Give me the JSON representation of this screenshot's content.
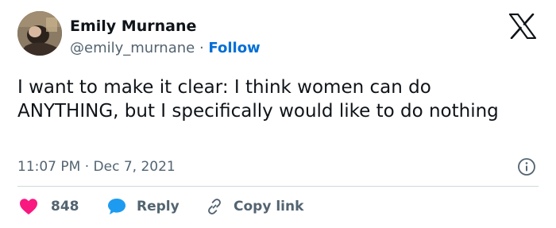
{
  "author": {
    "name": "Emily Murnane",
    "handle": "@emily_murnane",
    "separator": "·",
    "follow_label": "Follow"
  },
  "tweet": {
    "text": "I want to make it clear: I think women can do ANYTHING, but I specifically would like to do nothing",
    "timestamp": "11:07 PM · Dec 7, 2021"
  },
  "actions": {
    "like_count": "848",
    "reply_label": "Reply",
    "copy_label": "Copy link"
  },
  "colors": {
    "like": "#f91880",
    "reply": "#1d9bf0",
    "follow": "#006fd6",
    "muted": "#536471"
  },
  "icons": {
    "brand": "x-logo-icon",
    "info": "info-icon",
    "like": "heart-icon",
    "reply": "speech-bubble-icon",
    "copy": "link-icon"
  }
}
